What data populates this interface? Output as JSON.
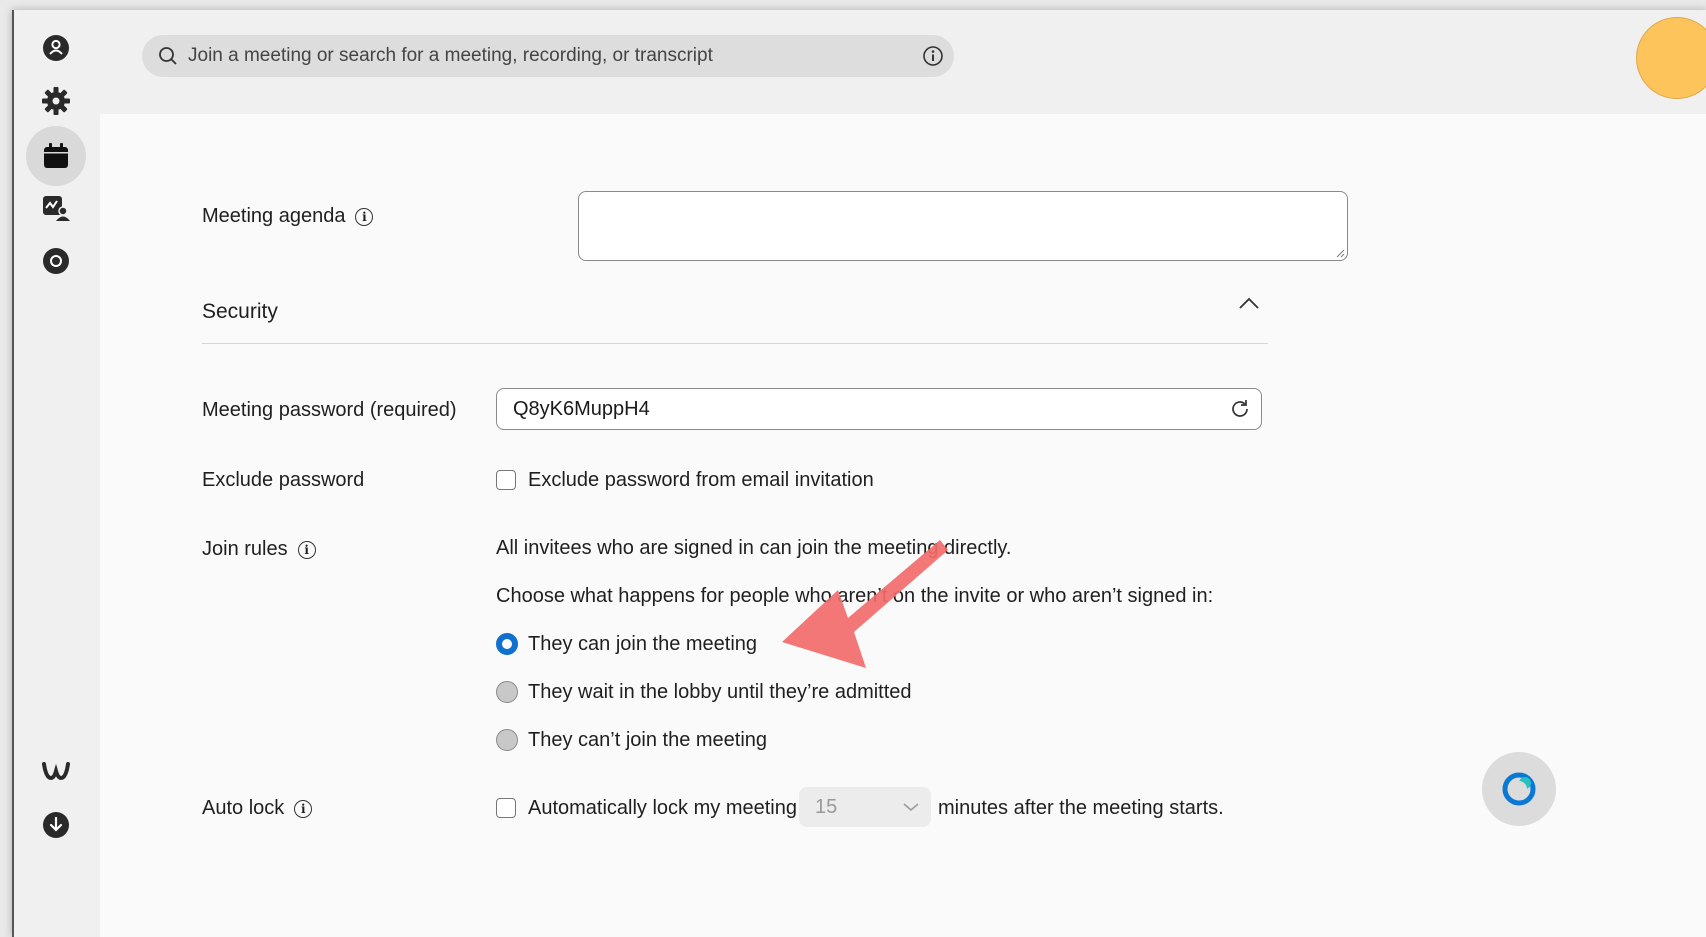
{
  "search": {
    "placeholder": "Join a meeting or search for a meeting, recording, or transcript"
  },
  "sidebar": {
    "items": [
      {
        "icon": "contacts-icon"
      },
      {
        "icon": "settings-gear-icon"
      },
      {
        "icon": "calendar-icon",
        "active": true
      },
      {
        "icon": "insights-icon"
      },
      {
        "icon": "recordings-icon"
      },
      {
        "icon": "webex-logo-icon"
      },
      {
        "icon": "download-icon"
      }
    ]
  },
  "form": {
    "agenda_label": "Meeting agenda",
    "security_title": "Security",
    "password_label": "Meeting password (required)",
    "password_value": "Q8yK6MuppH4",
    "exclude_label": "Exclude password",
    "exclude_checkbox_text": "Exclude password from email invitation",
    "join_rules_label": "Join rules",
    "join_rules_desc": "All invitees who are signed in can join the meeting directly.",
    "join_rules_question": "Choose what happens for people who aren’t on the invite or who aren’t signed in:",
    "options": [
      {
        "label": "They can join the meeting",
        "selected": true
      },
      {
        "label": "They wait in the lobby until they’re admitted",
        "selected": false
      },
      {
        "label": "They can’t join the meeting",
        "selected": false
      }
    ],
    "auto_lock_label": "Auto lock",
    "auto_lock_text": "Automatically lock my meeting",
    "auto_lock_minutes": "15",
    "auto_lock_suffix": "minutes after the meeting starts."
  },
  "colors": {
    "accent": "#1170cf",
    "avatar": "#fcc45b",
    "annotation_arrow": "#f26b6b"
  }
}
